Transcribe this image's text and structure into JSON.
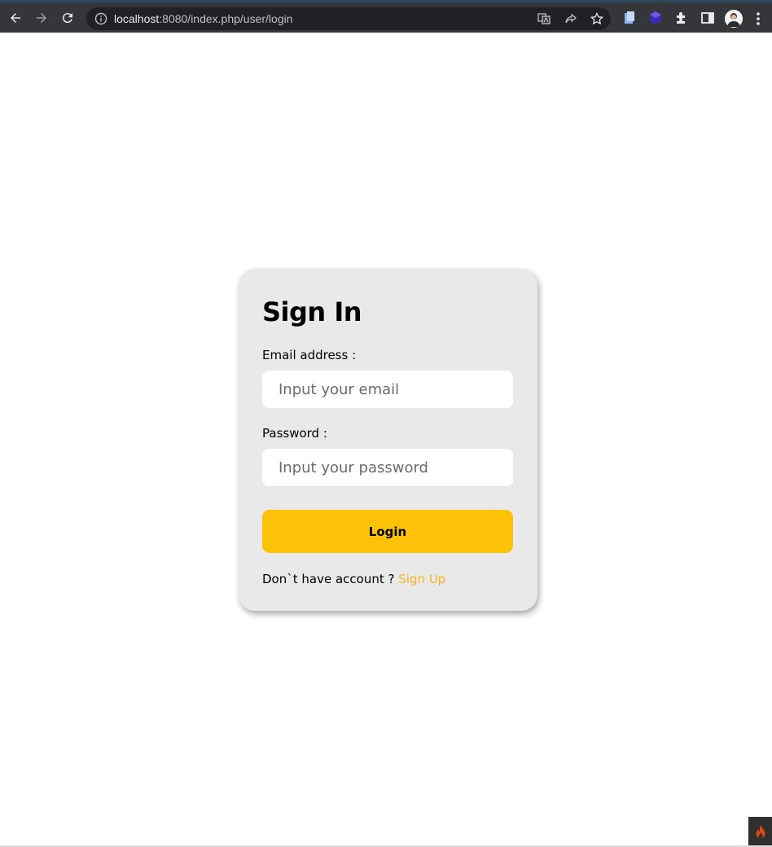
{
  "browser": {
    "url_host": "localhost",
    "url_rest": ":8080/index.php/user/login"
  },
  "form": {
    "title": "Sign In",
    "email_label": "Email address :",
    "email_placeholder": "Input your email",
    "password_label": "Password :",
    "password_placeholder": "Input your password",
    "login_label": "Login",
    "signup_prompt": "Don`t have account ? ",
    "signup_link": "Sign Up"
  },
  "colors": {
    "accent": "#fdc108",
    "link": "#f5b423",
    "card": "#e9e9e9"
  }
}
